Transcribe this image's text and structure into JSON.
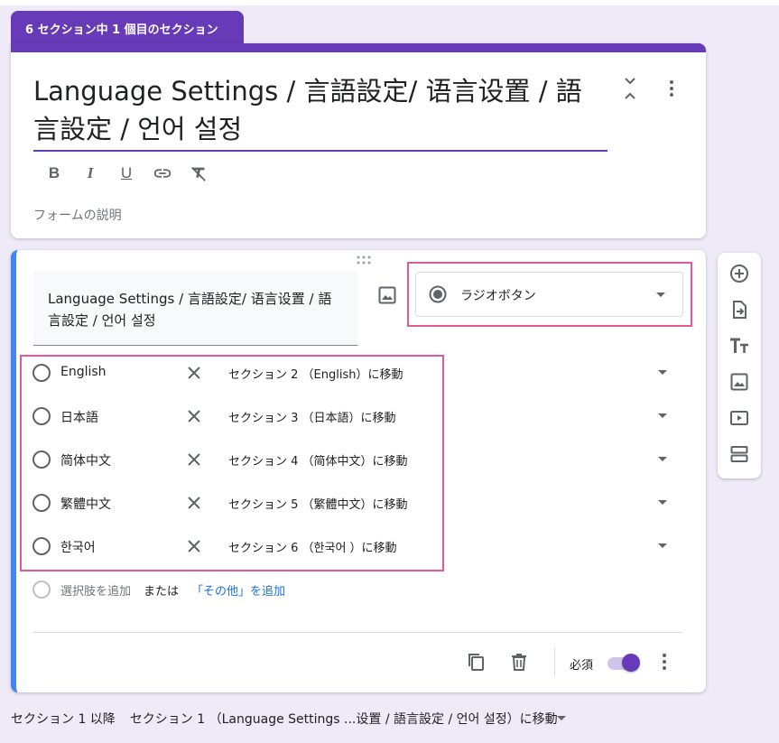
{
  "section_tab": "6 セクション中 1 個目のセクション",
  "form": {
    "title": "Language Settings / 言語設定/ 语言设置 / 語言設定 / 언어 설정",
    "description_placeholder": "フォームの説明"
  },
  "formatting": [
    "B",
    "I",
    "U"
  ],
  "question": {
    "title": "Language Settings / 言語設定/ 语言设置 / 語言設定 / 언어 설정",
    "type_label": "ラジオボタン",
    "options": [
      {
        "label": "English",
        "goto": "セクション 2 （English）に移動"
      },
      {
        "label": "日本語",
        "goto": "セクション 3 （日本語）に移動"
      },
      {
        "label": "简体中文",
        "goto": "セクション 4 （简体中文）に移動"
      },
      {
        "label": "繁體中文",
        "goto": "セクション 5 （繁體中文）に移動"
      },
      {
        "label": "한국어",
        "goto": "セクション 6 （한국어 ）に移動"
      }
    ],
    "add_option": "選択肢を追加",
    "or": "または",
    "add_other": "「その他」を追加",
    "required_label": "必須",
    "required": true
  },
  "after_section": {
    "label": "セクション 1 以降",
    "goto": "セクション 1 （Language Settings ...设置 / 語言設定 / 언어 설정）に移動"
  },
  "colors": {
    "accent": "#673ab7",
    "active_border": "#4285f4",
    "highlight": "#e4589a",
    "link": "#1a73e8",
    "background": "#efeaf7"
  },
  "icons": [
    "collapse-icon",
    "more-vert-icon",
    "bold-icon",
    "italic-icon",
    "underline-icon",
    "link-icon",
    "clear-format-icon",
    "drag-handle-icon",
    "image-icon",
    "radio-checked-icon",
    "dropdown-arrow-icon",
    "close-icon",
    "copy-icon",
    "trash-icon",
    "add-circle-icon",
    "import-icon",
    "title-icon",
    "video-icon",
    "section-icon"
  ]
}
